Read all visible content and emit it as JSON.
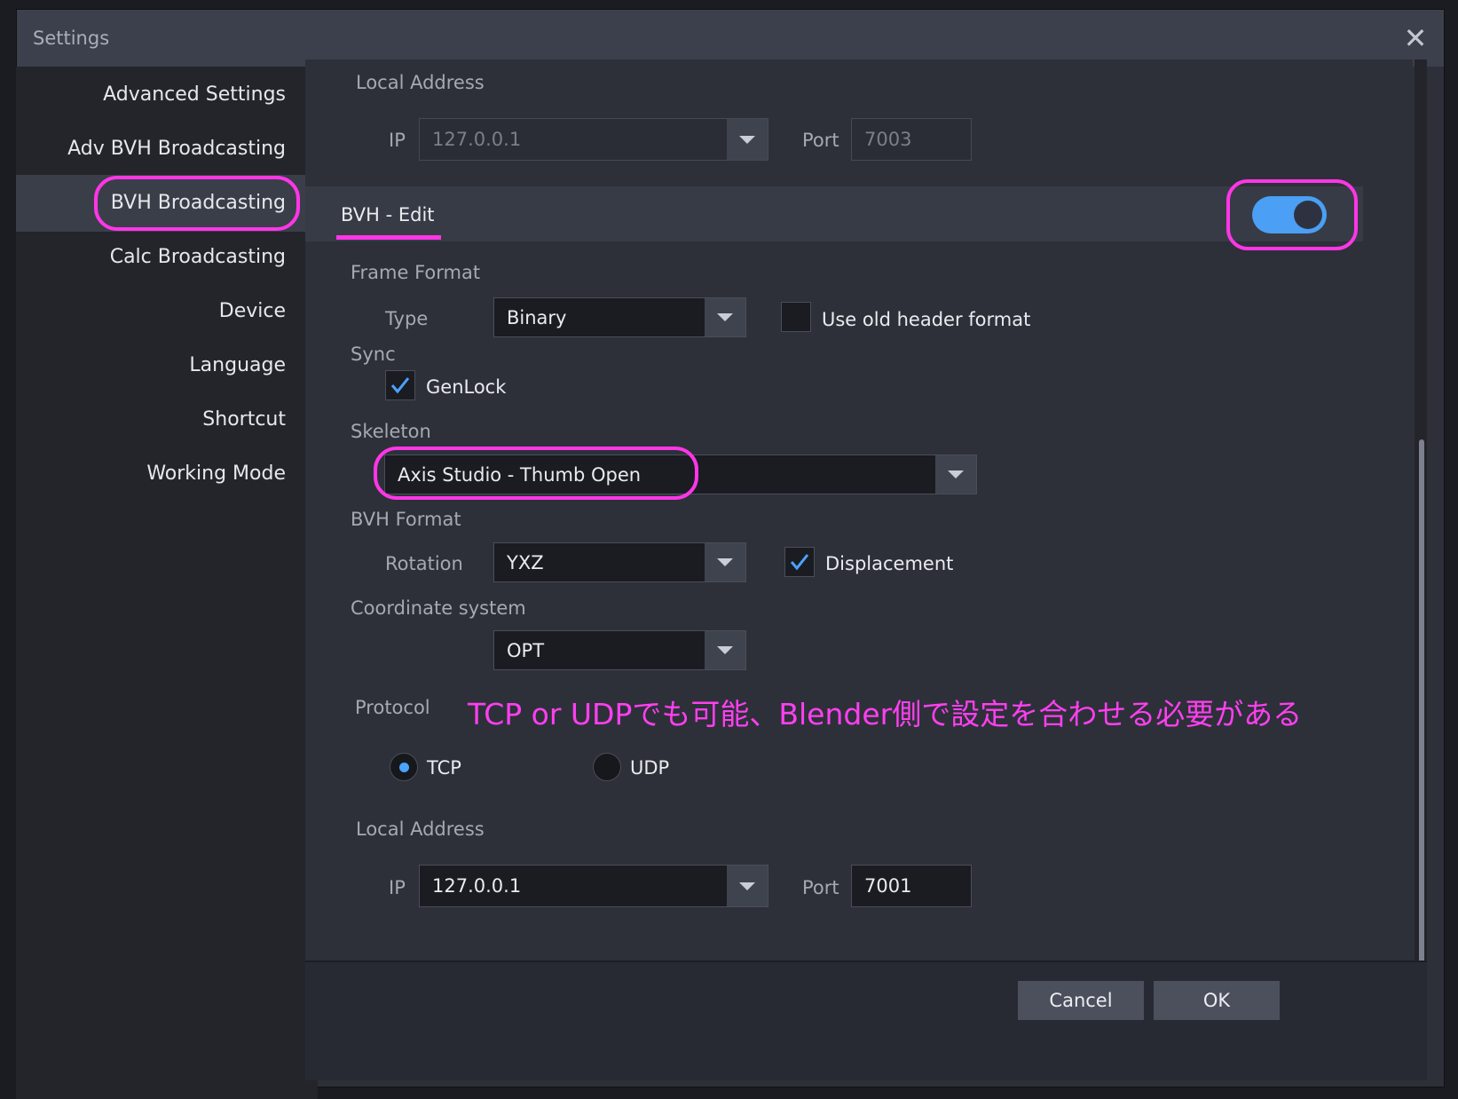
{
  "window": {
    "title": "Settings",
    "close_icon": "close-icon"
  },
  "sidebar": {
    "items": [
      {
        "label": "Advanced Settings"
      },
      {
        "label": "Adv BVH Broadcasting"
      },
      {
        "label": "BVH Broadcasting",
        "active": true
      },
      {
        "label": "Calc Broadcasting"
      },
      {
        "label": "Device"
      },
      {
        "label": "Language"
      },
      {
        "label": "Shortcut"
      },
      {
        "label": "Working Mode"
      }
    ]
  },
  "top_address": {
    "heading": "Local Address",
    "ip_label": "IP",
    "ip_value": "127.0.0.1",
    "port_label": "Port",
    "port_value": "7003",
    "disabled": true
  },
  "section": {
    "tab_label": "BVH - Edit",
    "toggle_on": true
  },
  "frame_format": {
    "heading": "Frame Format",
    "type_label": "Type",
    "type_value": "Binary",
    "old_header_label": "Use old header format",
    "old_header_checked": false
  },
  "sync": {
    "heading": "Sync",
    "genlock_label": "GenLock",
    "genlock_checked": true
  },
  "skeleton": {
    "heading": "Skeleton",
    "value": "Axis Studio - Thumb Open"
  },
  "bvh_format": {
    "heading": "BVH Format",
    "rotation_label": "Rotation",
    "rotation_value": "YXZ",
    "displacement_label": "Displacement",
    "displacement_checked": true
  },
  "coordinate": {
    "heading": "Coordinate system",
    "value": "OPT"
  },
  "protocol": {
    "heading": "Protocol",
    "annotation": "TCP or UDPでも可能、Blender側で設定を合わせる必要がある",
    "options": [
      {
        "label": "TCP",
        "selected": true
      },
      {
        "label": "UDP",
        "selected": false
      }
    ]
  },
  "bottom_address": {
    "heading": "Local Address",
    "ip_label": "IP",
    "ip_value": "127.0.0.1",
    "port_label": "Port",
    "port_value": "7001"
  },
  "footer": {
    "cancel_label": "Cancel",
    "ok_label": "OK"
  },
  "colors": {
    "highlight": "#ff36e6",
    "accent": "#4b9ff4",
    "annotation": "#ff3ff0"
  }
}
